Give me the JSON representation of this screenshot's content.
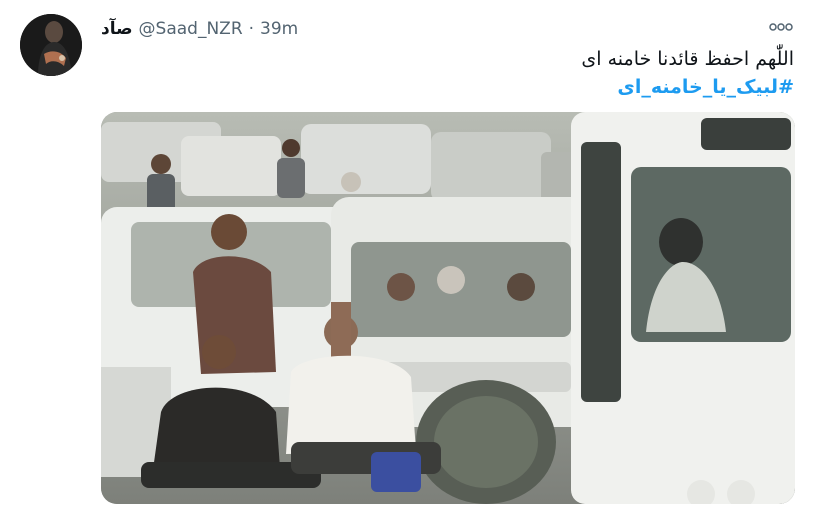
{
  "author": {
    "display_name": "صآد",
    "handle": "@Saad_NZR",
    "separator": "·",
    "timestamp": "39m"
  },
  "tweet": {
    "text_line1": "اللّٰهم احفظ قائدنا خامنه ای",
    "hashtag": "#لبیک_یا_خامنه_ای"
  },
  "icons": {
    "more": "more-options-icon",
    "avatar": "profile-avatar"
  },
  "colors": {
    "hashtag": "#1d9bf0",
    "text": "#0f1419",
    "muted": "#536471"
  }
}
